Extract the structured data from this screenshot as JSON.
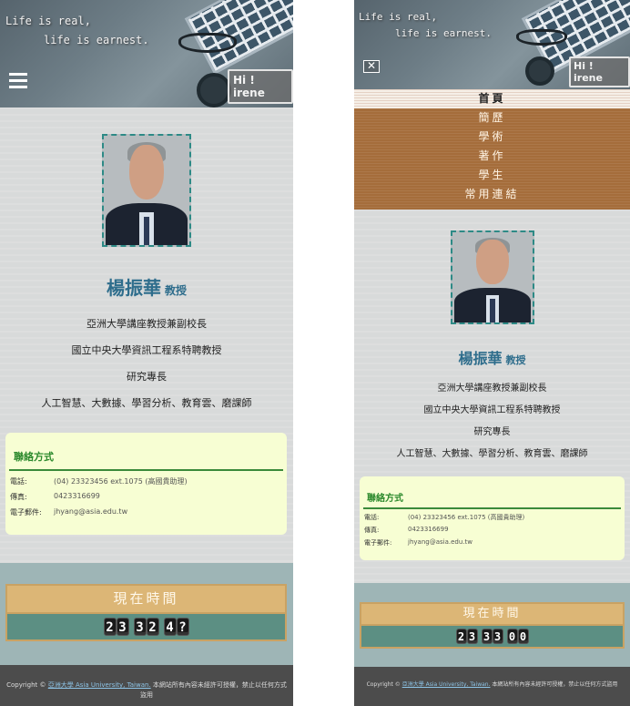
{
  "header": {
    "quote_line1": "Life is real,",
    "quote_line2": "life is earnest.",
    "greeting": "Hi ! irene"
  },
  "menu": {
    "items": [
      {
        "label": "首頁",
        "active": true
      },
      {
        "label": "簡歷"
      },
      {
        "label": "學術"
      },
      {
        "label": "著作"
      },
      {
        "label": "學生"
      },
      {
        "label": "常用連結"
      }
    ]
  },
  "profile": {
    "name": "楊振華",
    "title": "教授",
    "lines": [
      "亞洲大學講座教授兼副校長",
      "國立中央大學資訊工程系特聘教授",
      "研究專長",
      "人工智慧、大數據、學習分析、教育雲、磨課師"
    ]
  },
  "contact": {
    "heading": "聯絡方式",
    "rows": [
      {
        "key": "電話:",
        "value": "(04) 23323456 ext.1075 (高國貴助理)"
      },
      {
        "key": "傳真:",
        "value": "0423316699"
      },
      {
        "key": "電子郵件:",
        "value": "jhyang@asia.edu.tw"
      }
    ]
  },
  "clock": {
    "label": "現在時間",
    "left_digits": [
      "2",
      "3",
      "3",
      "2",
      "4",
      "?"
    ],
    "right_digits": [
      "2",
      "3",
      "3",
      "3",
      "0",
      "0"
    ]
  },
  "footer": {
    "prefix": "Copyright ©",
    "link_text": "亞洲大學 Asia University, Taiwan.",
    "notice": "本網站所有內容未經許可授權，禁止以任何方式盜用"
  },
  "colors": {
    "accent_name": "#2e6d8c",
    "contact_heading": "#2d8a2d",
    "menu_bg": "#a56d3b",
    "clock_label_bg": "#dcb676",
    "clock_bar_bg": "#5c8f83",
    "footer_bg": "#4c4c4c"
  },
  "icons": {
    "menu_open": "hamburger-icon",
    "menu_close": "close-icon"
  }
}
